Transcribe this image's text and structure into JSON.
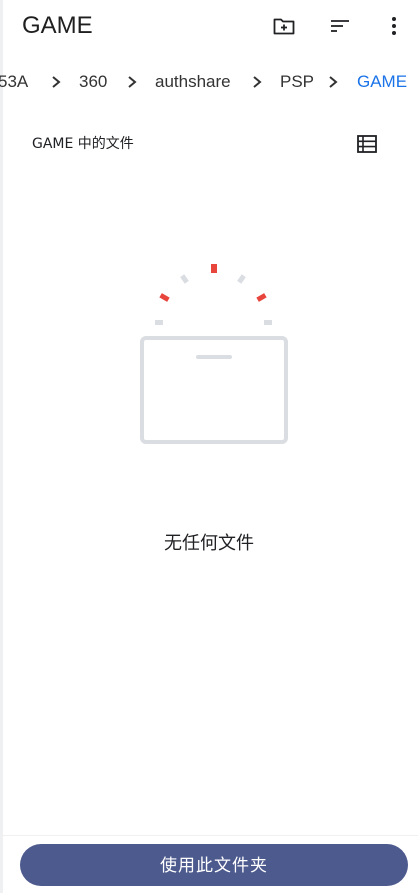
{
  "app_bar": {
    "title": "GAME",
    "new_folder_icon": "create-folder-icon",
    "sort_icon": "sort-icon",
    "more_icon": "more-vertical-icon"
  },
  "breadcrumb": {
    "items": [
      "53A",
      "360",
      "authshare",
      "PSP",
      "GAME"
    ],
    "current_index": 4,
    "separator_icon": "chevron-right-icon"
  },
  "section": {
    "title": "GAME 中的文件",
    "view_icon": "list-view-icon"
  },
  "empty_state": {
    "illustration_icon": "empty-box-icon",
    "message": "无任何文件"
  },
  "footer": {
    "primary_button_label": "使用此文件夹"
  },
  "colors": {
    "accent": "#1a73e8",
    "primary_button": "#4d5a8e",
    "illustration_stroke": "#dadde1",
    "illustration_spark": "#e8453c"
  }
}
